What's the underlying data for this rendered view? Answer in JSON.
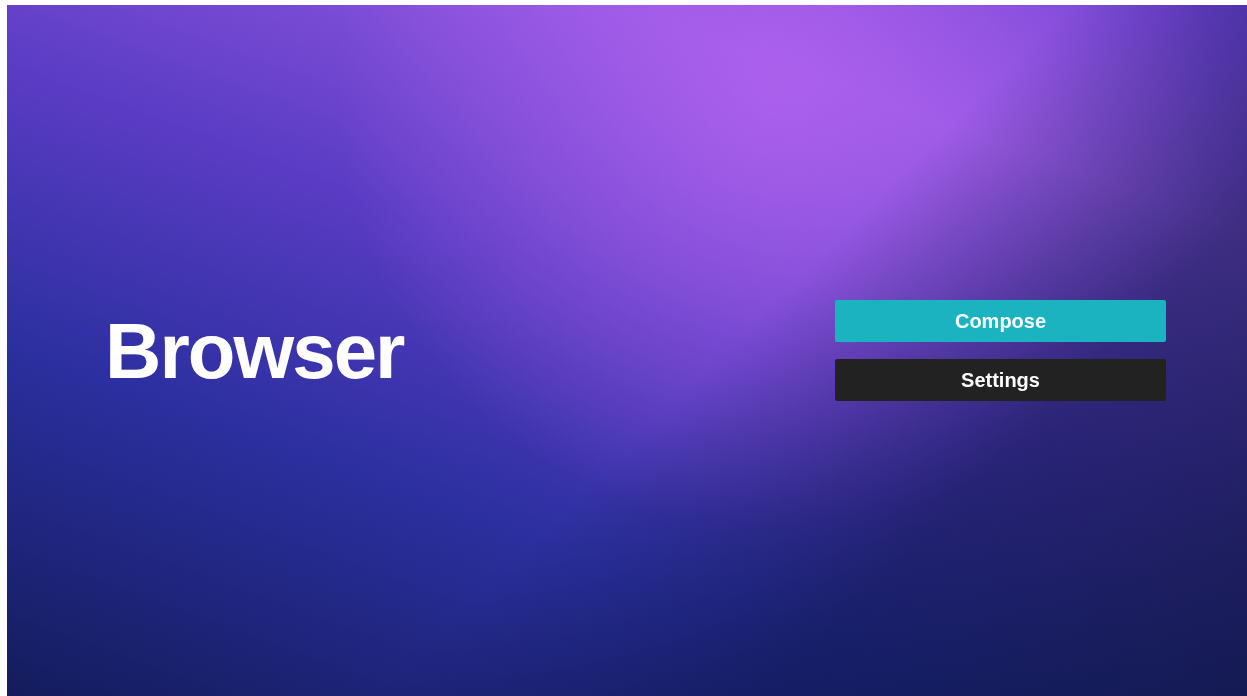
{
  "title": "Browser",
  "buttons": [
    {
      "label": "Compose",
      "selected": true
    },
    {
      "label": "Settings",
      "selected": false
    }
  ]
}
